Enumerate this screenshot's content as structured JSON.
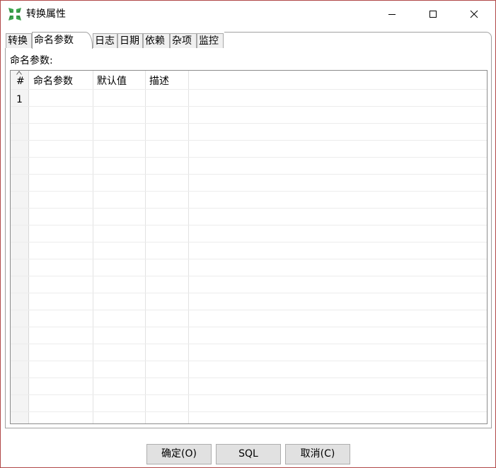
{
  "window": {
    "title": "转换属性",
    "controls": {
      "minimize": "minimize",
      "maximize": "maximize",
      "close": "close"
    }
  },
  "tabs": [
    {
      "label": "转换",
      "active": false
    },
    {
      "label": "命名参数",
      "active": true
    },
    {
      "label": "日志",
      "active": false
    },
    {
      "label": "日期",
      "active": false
    },
    {
      "label": "依赖",
      "active": false
    },
    {
      "label": "杂项",
      "active": false
    },
    {
      "label": "监控",
      "active": false
    }
  ],
  "panel": {
    "section_label": "命名参数:",
    "table": {
      "columns": [
        "#",
        "命名参数",
        "默认值",
        "描述"
      ],
      "rows": [
        [
          "1",
          "",
          "",
          ""
        ]
      ]
    }
  },
  "buttons": {
    "ok": "确定(O)",
    "sql": "SQL",
    "cancel": "取消(C)"
  },
  "icons": {
    "app": "transformation-icon",
    "sort": "sort-caret-icon"
  }
}
